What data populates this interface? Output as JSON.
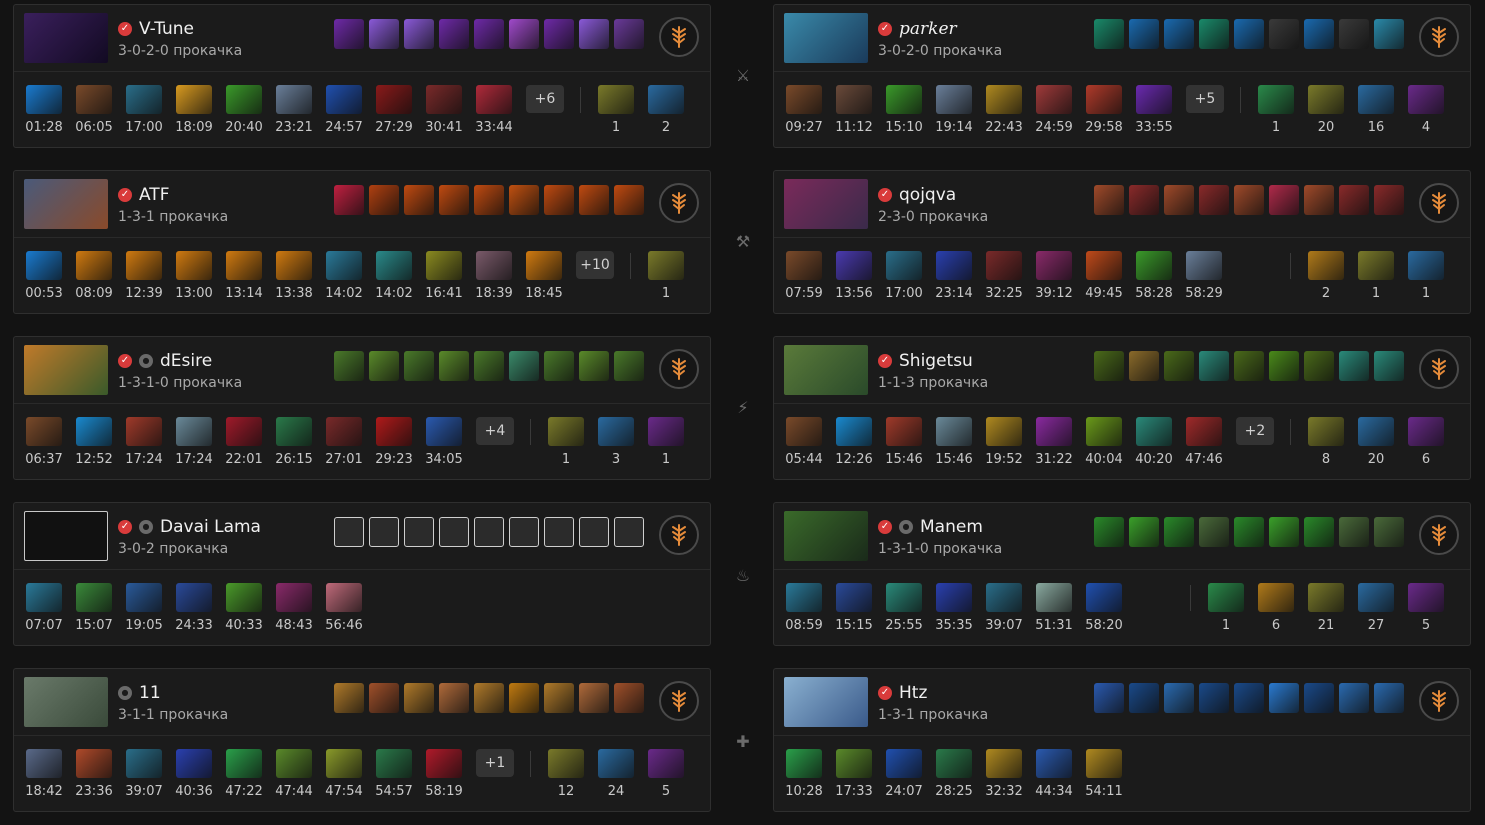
{
  "left": [
    {
      "name": "V-Tune",
      "italic": false,
      "verified": true,
      "anon": false,
      "build": "3-0-2-0 прокачка",
      "portrait": [
        "#3a1f5c",
        "#120a22"
      ],
      "abilities": [
        "#6e2aa8",
        "#8a5ad8",
        "#8a5ad8",
        "#6e2aa8",
        "#6e2aa8",
        "#a04acb",
        "#6e2aa8",
        "#8a5ad8",
        "#6a3a9a"
      ],
      "items": [
        [
          "#1a7bd0",
          "01:28"
        ],
        [
          "#7a4a2a",
          "06:05"
        ],
        [
          "#2a6e8a",
          "17:00"
        ],
        [
          "#d89a20",
          "18:09"
        ],
        [
          "#3a9a2a",
          "20:40"
        ],
        [
          "#6a7f9a",
          "23:21"
        ],
        [
          "#2050b0",
          "24:57"
        ],
        [
          "#8a1a1a",
          "27:29"
        ],
        [
          "#7a2a2a",
          "30:41"
        ],
        [
          "#b02a3a",
          "33:44"
        ]
      ],
      "more": "+6",
      "neutral": [
        [
          "#7a7a2a",
          "1"
        ],
        [
          "#2a6aa0",
          "2"
        ]
      ]
    },
    {
      "name": "ATF",
      "italic": false,
      "verified": true,
      "anon": false,
      "build": "1-3-1 прокачка",
      "portrait": [
        "#4a5a7a",
        "#8a4a2a"
      ],
      "abilities": [
        "#c02040",
        "#b04010",
        "#c04a10",
        "#c04a10",
        "#c04a10",
        "#c05010",
        "#c04a10",
        "#c04a10",
        "#c04a10"
      ],
      "items": [
        [
          "#1a7bd0",
          "00:53"
        ],
        [
          "#d07a10",
          "08:09"
        ],
        [
          "#d07a10",
          "12:39"
        ],
        [
          "#d07a10",
          "13:00"
        ],
        [
          "#d07a10",
          "13:14"
        ],
        [
          "#d07a10",
          "13:38"
        ],
        [
          "#2a7a9a",
          "14:02"
        ],
        [
          "#2a8a8a",
          "14:02"
        ],
        [
          "#8a8a20",
          "16:41"
        ],
        [
          "#7a5a6a",
          "18:39"
        ],
        [
          "#d07a10",
          "18:45"
        ]
      ],
      "more": "+10",
      "neutral": [
        [
          "#7a7a2a",
          "1"
        ]
      ]
    },
    {
      "name": "dEsire",
      "italic": false,
      "verified": true,
      "anon": true,
      "build": "1-3-1-0 прокачка",
      "portrait": [
        "#c07a2a",
        "#3a5a2a"
      ],
      "abilities": [
        "#4a7a2a",
        "#5a8a2a",
        "#4a7a2a",
        "#5a8a2a",
        "#4a7a2a",
        "#3a8a6a",
        "#4a7a2a",
        "#5a8a2a",
        "#4a7a2a"
      ],
      "items": [
        [
          "#7a4a2a",
          "06:37"
        ],
        [
          "#1a8ad0",
          "12:52"
        ],
        [
          "#a03a2a",
          "17:24"
        ],
        [
          "#6a8a9a",
          "17:24"
        ],
        [
          "#a01a2a",
          "22:01"
        ],
        [
          "#2a7a4a",
          "26:15"
        ],
        [
          "#7a2a2a",
          "27:01"
        ],
        [
          "#b01a1a",
          "29:23"
        ],
        [
          "#2a5ab0",
          "34:05"
        ]
      ],
      "more": "+4",
      "neutral": [
        [
          "#7a7a2a",
          "1"
        ],
        [
          "#2a6aa0",
          "3"
        ],
        [
          "#6a2a8a",
          "1"
        ]
      ]
    },
    {
      "name": "Davai Lama",
      "italic": false,
      "verified": true,
      "anon": true,
      "build": "3-0-2 прокачка",
      "portrait": null,
      "abilities": [
        "broken",
        "broken",
        "broken",
        "broken",
        "broken",
        "broken",
        "broken",
        "broken",
        "broken"
      ],
      "items": [
        [
          "#2a7a9a",
          "07:07"
        ],
        [
          "#3a8a3a",
          "15:07"
        ],
        [
          "#2a5a9a",
          "19:05"
        ],
        [
          "#2a4a9a",
          "24:33"
        ],
        [
          "#4a9a2a",
          "40:33"
        ],
        [
          "#8a2a6a",
          "48:43"
        ],
        [
          "#c06a7a",
          "56:46"
        ]
      ],
      "more": "",
      "neutral": []
    },
    {
      "name": "11",
      "italic": false,
      "verified": false,
      "anon": true,
      "build": "3-1-1 прокачка",
      "portrait": [
        "#6a7a6a",
        "#3a4a3a"
      ],
      "abilities": [
        "#b07a2a",
        "#a0502a",
        "#b07a2a",
        "#b06a3a",
        "#b07a2a",
        "#c07a10",
        "#b07a2a",
        "#b06a3a",
        "#a0502a"
      ],
      "items": [
        [
          "#5a6a8a",
          "18:42"
        ],
        [
          "#b04a2a",
          "23:36"
        ],
        [
          "#2a6e8a",
          "39:07"
        ],
        [
          "#2a40b0",
          "40:36"
        ],
        [
          "#2aa04a",
          "47:22"
        ],
        [
          "#5a8a2a",
          "47:44"
        ],
        [
          "#8a9a2a",
          "47:54"
        ],
        [
          "#2a7a4a",
          "54:57"
        ],
        [
          "#b01a2a",
          "58:19"
        ]
      ],
      "more": "+1",
      "neutral": [
        [
          "#7a7a2a",
          "12"
        ],
        [
          "#2a6aa0",
          "24"
        ],
        [
          "#6a2a8a",
          "5"
        ]
      ]
    }
  ],
  "right": [
    {
      "name": "parker",
      "italic": true,
      "verified": true,
      "anon": false,
      "build": "3-0-2-0 прокачка",
      "portrait": [
        "#3a8aaa",
        "#1a3a5a"
      ],
      "abilities": [
        "#1a8a6a",
        "#1a6ab0",
        "#1a6ab0",
        "#1a8a6a",
        "#1a6ab0",
        "#3a3a3a",
        "#1a6ab0",
        "#3a3a3a",
        "#2a8aaa"
      ],
      "items": [
        [
          "#7a4a2a",
          "09:27"
        ],
        [
          "#6a4a3a",
          "11:12"
        ],
        [
          "#3a9a2a",
          "15:10"
        ],
        [
          "#6a7f9a",
          "19:14"
        ],
        [
          "#b08a20",
          "22:43"
        ],
        [
          "#a03a3a",
          "24:59"
        ],
        [
          "#b03a2a",
          "29:58"
        ],
        [
          "#6a2ab0",
          "33:55"
        ]
      ],
      "more": "+5",
      "neutral": [
        [
          "#2a8a4a",
          "1"
        ],
        [
          "#7a7a2a",
          "20"
        ],
        [
          "#2a6aa0",
          "16"
        ],
        [
          "#6a2a8a",
          "4"
        ]
      ]
    },
    {
      "name": "qojqva",
      "italic": false,
      "verified": true,
      "anon": false,
      "build": "2-3-0 прокачка",
      "portrait": [
        "#7a2a5a",
        "#3a2a4a"
      ],
      "abilities": [
        "#a04a2a",
        "#8a2a2a",
        "#a04a2a",
        "#8a2a2a",
        "#a04a2a",
        "#b02a4a",
        "#a04a2a",
        "#8a2a2a",
        "#8a2a2a"
      ],
      "items": [
        [
          "#7a4a2a",
          "07:59"
        ],
        [
          "#4a3ab0",
          "13:56"
        ],
        [
          "#2a6e8a",
          "17:00"
        ],
        [
          "#2a40b0",
          "23:14"
        ],
        [
          "#7a2a2a",
          "32:25"
        ],
        [
          "#8a2a6a",
          "39:12"
        ],
        [
          "#c04a1a",
          "49:45"
        ],
        [
          "#3a9a2a",
          "58:28"
        ],
        [
          "#6a7f9a",
          "58:29"
        ]
      ],
      "more": "",
      "neutral": [
        [
          "#b07a1a",
          "2"
        ],
        [
          "#7a7a2a",
          "1"
        ],
        [
          "#2a6aa0",
          "1"
        ]
      ]
    },
    {
      "name": "Shigetsu",
      "italic": false,
      "verified": true,
      "anon": false,
      "build": "1-1-3 прокачка",
      "portrait": [
        "#5a7a3a",
        "#2a4a2a"
      ],
      "abilities": [
        "#4a6a1a",
        "#8a6a2a",
        "#4a6a1a",
        "#2a8a7a",
        "#4a6a1a",
        "#4a8a1a",
        "#4a6a1a",
        "#2a8a7a",
        "#2a8a7a"
      ],
      "items": [
        [
          "#7a4a2a",
          "05:44"
        ],
        [
          "#1a8ad0",
          "12:26"
        ],
        [
          "#a03a2a",
          "15:46"
        ],
        [
          "#6a8a9a",
          "15:46"
        ],
        [
          "#b08a20",
          "19:52"
        ],
        [
          "#8a2aa0",
          "31:22"
        ],
        [
          "#6a9a1a",
          "40:04"
        ],
        [
          "#2a8a7a",
          "40:20"
        ],
        [
          "#a02a2a",
          "47:46"
        ]
      ],
      "more": "+2",
      "neutral": [
        [
          "#7a7a2a",
          "8"
        ],
        [
          "#2a6aa0",
          "20"
        ],
        [
          "#6a2a8a",
          "6"
        ]
      ]
    },
    {
      "name": "Manem",
      "italic": false,
      "verified": true,
      "anon": true,
      "build": "1-3-1-0 прокачка",
      "portrait": [
        "#3a6a2a",
        "#1a2a1a"
      ],
      "abilities": [
        "#2a8a2a",
        "#3aa02a",
        "#2a8a2a",
        "#4a6a3a",
        "#2a8a2a",
        "#3aa02a",
        "#2a8a2a",
        "#4a6a3a",
        "#4a6a3a"
      ],
      "items": [
        [
          "#2a7a9a",
          "08:59"
        ],
        [
          "#2a4a9a",
          "15:15"
        ],
        [
          "#2a8a7a",
          "25:55"
        ],
        [
          "#2a40b0",
          "35:35"
        ],
        [
          "#2a6e8a",
          "39:07"
        ],
        [
          "#8aaaa0",
          "51:31"
        ],
        [
          "#2050b0",
          "58:20"
        ]
      ],
      "more": "",
      "neutral": [
        [
          "#2a8a4a",
          "1"
        ],
        [
          "#b07a1a",
          "6"
        ],
        [
          "#7a7a2a",
          "21"
        ],
        [
          "#2a6aa0",
          "27"
        ],
        [
          "#6a2a8a",
          "5"
        ]
      ]
    },
    {
      "name": "Htz",
      "italic": false,
      "verified": true,
      "anon": false,
      "build": "1-3-1 прокачка",
      "portrait": [
        "#8ab0d0",
        "#3a5a8a"
      ],
      "abilities": [
        "#2a5ab0",
        "#1a4a8a",
        "#2a6ab0",
        "#1a4a8a",
        "#1a4a8a",
        "#2a7ad0",
        "#1a4a8a",
        "#2a6ab0",
        "#2a6ab0"
      ],
      "items": [
        [
          "#2aa04a",
          "10:28"
        ],
        [
          "#5a8a2a",
          "17:33"
        ],
        [
          "#2050b0",
          "24:07"
        ],
        [
          "#2a7a4a",
          "28:25"
        ],
        [
          "#b08a20",
          "32:32"
        ],
        [
          "#2a5ab0",
          "44:34"
        ],
        [
          "#b08a20",
          "54:11"
        ]
      ],
      "more": "",
      "neutral": []
    }
  ],
  "side_icons": [
    "sword",
    "crossed-axe",
    "lightning",
    "flame-hand",
    "healing-hand"
  ]
}
